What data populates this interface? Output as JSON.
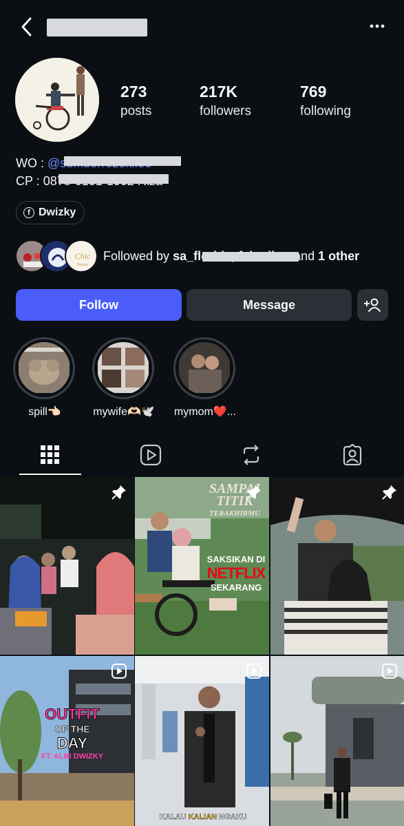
{
  "stats": {
    "posts_count": "273",
    "posts_label": "posts",
    "followers_count": "217K",
    "followers_label": "followers",
    "following_count": "769",
    "following_label": "following"
  },
  "bio": {
    "line1_prefix": "WO : ",
    "line1_link": "@sumberrezeki.88",
    "line2_prefix": "CP : ",
    "line2_number": "0878-0101-1002",
    "line2_suffix": " Riza"
  },
  "facebook_chip": {
    "label": "Dwizky",
    "icon": "facebook-icon"
  },
  "followed_by": {
    "prefix": "Followed by ",
    "names": "sa_florida, fahmihar",
    "middle": " and ",
    "other": "1 other"
  },
  "buttons": {
    "follow": "Follow",
    "message": "Message",
    "add_user_icon": "add-user-icon"
  },
  "highlights": [
    {
      "label": "spill👈🏻"
    },
    {
      "label": "mywife🫶🏻🕊️"
    },
    {
      "label": "mymom❤️..."
    }
  ],
  "tabs": [
    {
      "icon": "grid-icon",
      "selected": true
    },
    {
      "icon": "reels-icon",
      "selected": false
    },
    {
      "icon": "reposts-icon",
      "selected": false
    },
    {
      "icon": "tagged-icon",
      "selected": false
    }
  ],
  "posts": [
    {
      "badge": "pin-icon"
    },
    {
      "badge": "pin-icon",
      "title_line1": "SAMPAI",
      "title_line2": "TITIK",
      "title_line3": "TERAKHIRMU",
      "cta_line1": "SAKSIKAN DI",
      "cta_line2": "NETFLIX",
      "cta_line3": "SEKARANG"
    },
    {
      "badge": "pin-icon"
    },
    {
      "badge": "reel-icon",
      "text_line1": "OUTFIT",
      "text_line2": "OF THE",
      "text_line3": "DAY",
      "text_line4": "FT. ALBI DWIZKY"
    },
    {
      "badge": "reel-icon",
      "caption_a": "KALAU ",
      "caption_b": "KALIAN",
      "caption_c": " NGAKU"
    },
    {
      "badge": "reel-icon"
    }
  ],
  "colors": {
    "background": "#0b0f14",
    "follow_button": "#4a5df9",
    "link": "#6d8dff",
    "secondary_button": "#2b2f36"
  }
}
